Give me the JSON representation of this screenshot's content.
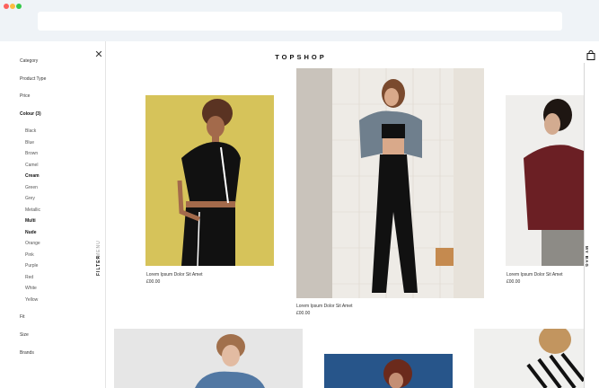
{
  "browser": {
    "dots": [
      "#fc605c",
      "#fdbc40",
      "#34c84a"
    ],
    "url": ""
  },
  "header": {
    "logo": "TOPSHOP",
    "bag_icon": "shopping-bag-icon"
  },
  "sidebar": {
    "close_icon": "close-icon",
    "headings": {
      "category": "Category",
      "product_type": "Product Type",
      "price": "Price",
      "colour": "Colour (3)",
      "fit": "Fit",
      "size": "Size",
      "brands": "Brands"
    },
    "colours": [
      {
        "label": "Black",
        "selected": false
      },
      {
        "label": "Blue",
        "selected": false
      },
      {
        "label": "Brown",
        "selected": false
      },
      {
        "label": "Camel",
        "selected": false
      },
      {
        "label": "Cream",
        "selected": true
      },
      {
        "label": "Green",
        "selected": false
      },
      {
        "label": "Grey",
        "selected": false
      },
      {
        "label": "Metallic",
        "selected": false
      },
      {
        "label": "Multi",
        "selected": true
      },
      {
        "label": "Nude",
        "selected": true
      },
      {
        "label": "Orange",
        "selected": false
      },
      {
        "label": "Pink",
        "selected": false
      },
      {
        "label": "Purple",
        "selected": false
      },
      {
        "label": "Red",
        "selected": false
      },
      {
        "label": "White",
        "selected": false
      },
      {
        "label": "Yellow",
        "selected": false
      }
    ],
    "tabs": {
      "filter": "FILTER",
      "menu": "MENU"
    }
  },
  "right_tab": "MY BAG",
  "products": [
    {
      "name": "Lorem Ipsum Dolor Sit Amet",
      "price": "£00.00",
      "bg": "#d8c55a"
    },
    {
      "name": "Lorem Ipsum Dolor Sit Amet",
      "price": "£00.00",
      "bg": "#ece9e4"
    },
    {
      "name": "Lorem Ipsum Dolor Sit Amet",
      "price": "£00.00",
      "bg": "#efeeec"
    },
    {
      "name": "",
      "price": "",
      "bg": "#e6e6e6"
    },
    {
      "name": "",
      "price": "",
      "bg": "#27558a"
    },
    {
      "name": "",
      "price": "",
      "bg": "#f2f2f2"
    }
  ]
}
